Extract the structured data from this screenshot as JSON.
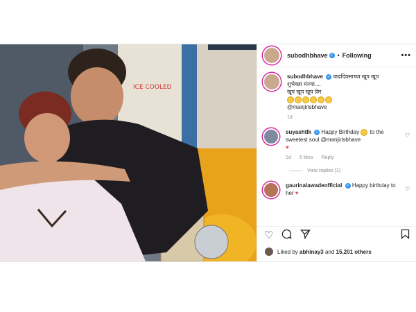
{
  "post": {
    "username": "subodhbhave",
    "separator": "•",
    "follow_status": "Following",
    "more_glyph": "•••"
  },
  "caption": {
    "username": "subodhbhave",
    "line1": "वाढदिवसाच्या खूप खूप",
    "line2": "शुभेच्छा मंज्या....",
    "line3": "खूप खूप खूप प्रेम",
    "mention": "@manjirisbhave",
    "age": "1d"
  },
  "comments": [
    {
      "username": "suyashtlk",
      "text": "Happy Birthday",
      "text2": "to the sweetest soul",
      "mention": "@manjirisbhave",
      "age": "1d",
      "likes": "6 likes",
      "reply": "Reply",
      "view_replies": "View replies (1)"
    },
    {
      "username": "gaurinalawadeofficial",
      "text": "Happy birthday to her"
    }
  ],
  "actions": {
    "like_icon": "heart-icon",
    "comment_icon": "comment-icon",
    "share_icon": "share-icon",
    "save_icon": "bookmark-icon"
  },
  "likes": {
    "prefix": "Liked by",
    "user": "abhinay3",
    "conj": "and",
    "count": "15,201 others"
  },
  "colors": {
    "verified": "#3897f0",
    "heart": "#ed4956",
    "muted": "#8e8e8e"
  }
}
